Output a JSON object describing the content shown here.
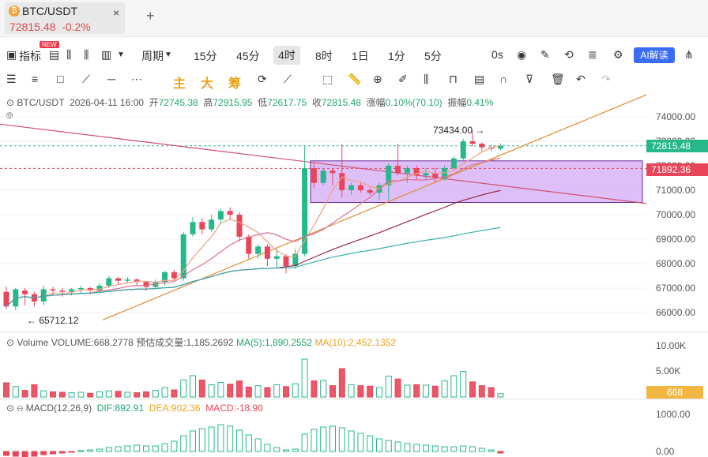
{
  "tab": {
    "symbol": "BTC/USDT",
    "price": "72815.48",
    "change": "-0.2%",
    "close": "×",
    "add": "+"
  },
  "toolbar": {
    "indicators": "指标",
    "new_badge": "NEW",
    "period": "周期",
    "intervals": [
      "15分",
      "45分",
      "4时",
      "8时",
      "1日",
      "1分",
      "5分"
    ],
    "active_interval": "4时",
    "timer": "0s",
    "ai_label": "AI解读"
  },
  "drawing": {
    "zhu": "主",
    "da": "大",
    "chou": "筹"
  },
  "info": {
    "pair": "BTC/USDT",
    "datetime": "2026-04-11 16:00",
    "open_label": "开",
    "open": "72745.38",
    "high_label": "高",
    "high": "72915.95",
    "low_label": "低",
    "low": "72617.75",
    "close_label": "收",
    "close": "72815.48",
    "change_label": "涨幅",
    "change": "0.10%(70.10)",
    "amp_label": "振幅",
    "amp": "0.41%"
  },
  "price_axis": [
    "74000.00",
    "73000.00",
    "72000.00",
    "71000.00",
    "70000.00",
    "69000.00",
    "68000.00",
    "67000.00",
    "66000.00"
  ],
  "current_price_tag": "72815.48",
  "red_line_tag": "71892.36",
  "max_label": "73434.00 →",
  "min_label": "← 65712.12",
  "volume": {
    "title": "Volume",
    "vol": "VOLUME:668.2778",
    "est": "预估成交量:1,185.2692",
    "ma5": "MA(5):1,890.2552",
    "ma10": "MA(10):2,452.1352",
    "axis": [
      "10.00K",
      "5.00K"
    ],
    "tag": "668"
  },
  "macd": {
    "title": "MACD(12,26,9)",
    "dif": "DIF:892.91",
    "dea": "DEA:902.36",
    "macd": "MACD:-18.90",
    "axis": [
      "1000.00",
      "0.00"
    ]
  },
  "colors": {
    "up": "#26b88a",
    "down": "#e8455a",
    "accent": "#3a6cf4",
    "box": "#c48af0"
  },
  "chart_data": {
    "type": "candlestick",
    "candles": [
      [
        66850,
        66250,
        67050,
        66150
      ],
      [
        66250,
        66950,
        67000,
        66100
      ],
      [
        66900,
        66750,
        67000,
        66300
      ],
      [
        66750,
        66450,
        66850,
        66250
      ],
      [
        66450,
        66950,
        67100,
        66300
      ],
      [
        66950,
        66900,
        67050,
        66700
      ],
      [
        66900,
        66850,
        67000,
        66650
      ],
      [
        66850,
        66950,
        67000,
        66700
      ],
      [
        66950,
        67000,
        67100,
        66800
      ],
      [
        67000,
        66900,
        67050,
        66750
      ],
      [
        66900,
        67100,
        67200,
        66800
      ],
      [
        67100,
        67400,
        67500,
        67000
      ],
      [
        67400,
        67300,
        67450,
        67150
      ],
      [
        67300,
        67350,
        67450,
        67200
      ],
      [
        67350,
        67250,
        67400,
        67100
      ],
      [
        67250,
        67050,
        67300,
        66900
      ],
      [
        67050,
        67250,
        67350,
        66950
      ],
      [
        67250,
        67650,
        67700,
        67100
      ],
      [
        67650,
        67400,
        67750,
        67300
      ],
      [
        67400,
        69200,
        69300,
        67300
      ],
      [
        69200,
        69700,
        69900,
        69100
      ],
      [
        69700,
        69400,
        69850,
        69200
      ],
      [
        69400,
        69800,
        70000,
        69300
      ],
      [
        69800,
        70150,
        70250,
        69600
      ],
      [
        70150,
        70000,
        70300,
        69800
      ],
      [
        70000,
        69100,
        70100,
        68900
      ],
      [
        69100,
        68400,
        69200,
        68200
      ],
      [
        68400,
        68700,
        68800,
        68200
      ],
      [
        68700,
        68200,
        68800,
        67900
      ],
      [
        68200,
        68300,
        68600,
        67800
      ],
      [
        68300,
        67900,
        68400,
        67600
      ],
      [
        67900,
        68400,
        68600,
        67800
      ],
      [
        68400,
        71900,
        72800,
        68300
      ],
      [
        71900,
        71300,
        72100,
        71100
      ],
      [
        71300,
        71800,
        71900,
        71200
      ],
      [
        71800,
        71700,
        71900,
        71200
      ],
      [
        71700,
        71000,
        72900,
        70700
      ],
      [
        71000,
        71200,
        71300,
        70800
      ],
      [
        71200,
        71000,
        71300,
        70900
      ],
      [
        71000,
        70900,
        71100,
        70800
      ],
      [
        70900,
        71200,
        71300,
        70600
      ],
      [
        71200,
        72000,
        72100,
        70600
      ],
      [
        72000,
        71700,
        72900,
        71600
      ],
      [
        71700,
        71900,
        72000,
        71300
      ],
      [
        71900,
        71600,
        72000,
        71400
      ],
      [
        71600,
        71700,
        71900,
        71400
      ],
      [
        71700,
        71500,
        71900,
        71300
      ],
      [
        71500,
        71900,
        72000,
        71400
      ],
      [
        71900,
        72300,
        72400,
        71800
      ],
      [
        72300,
        73000,
        73100,
        72200
      ],
      [
        73000,
        72900,
        73434,
        72800
      ],
      [
        72900,
        72750,
        72950,
        72600
      ],
      [
        72750,
        72700,
        72850,
        72600
      ],
      [
        72700,
        72815,
        72916,
        72618
      ]
    ],
    "volumes": [
      3,
      2.2,
      1.4,
      2.6,
      1.3,
      1.1,
      1.0,
      0.9,
      1.0,
      0.8,
      1.1,
      1.3,
      1.2,
      1.0,
      0.9,
      1.1,
      1.4,
      2.0,
      1.5,
      3.6,
      4.5,
      3.6,
      2.6,
      3.1,
      2.7,
      3.4,
      2.1,
      2.4,
      2.0,
      2.6,
      2.2,
      2.8,
      8.0,
      3.4,
      3.5,
      2.4,
      6.0,
      2.6,
      2.4,
      2.3,
      2.0,
      4.4,
      3.8,
      2.5,
      2.6,
      2.5,
      2.3,
      3.4,
      4.5,
      5.4,
      3.2,
      2.4,
      2.0,
      0.7
    ],
    "macd_hist": [
      -0.5,
      -0.6,
      -0.7,
      -0.6,
      -0.4,
      -0.3,
      -0.2,
      -0.1,
      0.1,
      0.2,
      0.3,
      0.5,
      0.6,
      0.7,
      0.8,
      0.7,
      0.7,
      1.0,
      1.3,
      2.0,
      2.6,
      2.9,
      3.1,
      3.4,
      3.2,
      2.7,
      2.1,
      1.6,
      0.9,
      0.5,
      0.2,
      0.3,
      2.2,
      2.8,
      3.1,
      3.2,
      3.0,
      2.6,
      2.3,
      2.0,
      1.6,
      1.4,
      1.2,
      1.0,
      0.9,
      0.8,
      0.7,
      0.6,
      0.6,
      0.7,
      0.6,
      0.4,
      0.2,
      -0.2
    ],
    "price_range": [
      65500,
      74800
    ]
  }
}
